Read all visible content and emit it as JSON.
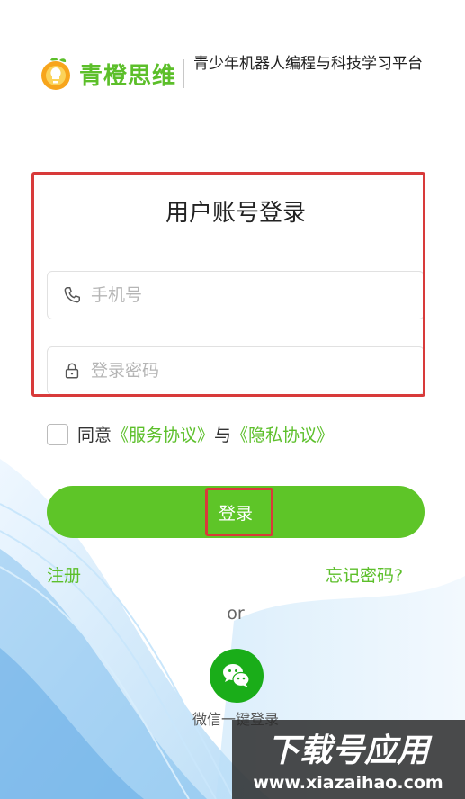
{
  "header": {
    "brand": "青橙思维",
    "tagline": "青少年机器人编程与科技学习平台"
  },
  "login": {
    "title": "用户账号登录",
    "phone_placeholder": "手机号",
    "password_placeholder": "登录密码",
    "agree_prefix": "同意",
    "service_link": "《服务协议》",
    "agree_and": "与",
    "privacy_link": "《隐私协议》",
    "submit_label": "登录",
    "register_link": "注册",
    "forgot_link": "忘记密码?",
    "or_text": "or",
    "wechat_label": "微信一键登录"
  },
  "watermark": {
    "text": "下载号应用",
    "url": "www.xiazaihao.com"
  },
  "colors": {
    "brand_green": "#5cbf2a",
    "button_green": "#5ec528",
    "wechat_green": "#1aad19",
    "annotation_red": "#d83a3a"
  },
  "icons": [
    "orange-logo-icon",
    "phone-icon",
    "lock-icon",
    "wechat-icon"
  ]
}
